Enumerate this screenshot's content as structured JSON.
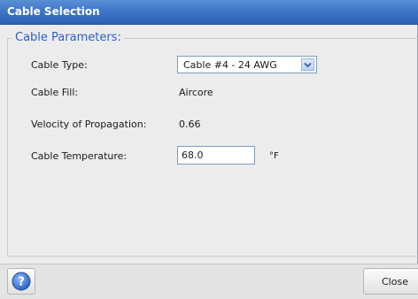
{
  "dialog": {
    "title": "Cable Selection"
  },
  "group": {
    "legend": "Cable Parameters:"
  },
  "fields": {
    "cable_type_label": "Cable Type:",
    "cable_type_value": "Cable #4 - 24 AWG",
    "cable_fill_label": "Cable Fill:",
    "cable_fill_value": "Aircore",
    "velocity_label": "Velocity of Propagation:",
    "velocity_value": "0.66",
    "temperature_label": "Cable Temperature:",
    "temperature_value": "68.0",
    "temperature_unit": "°F"
  },
  "footer": {
    "help_icon": "help-icon",
    "close_label": "Close"
  },
  "colors": {
    "title_bar": "#3f76c8",
    "legend_text": "#2f5fc4",
    "help_icon": "#3b7bd6"
  }
}
